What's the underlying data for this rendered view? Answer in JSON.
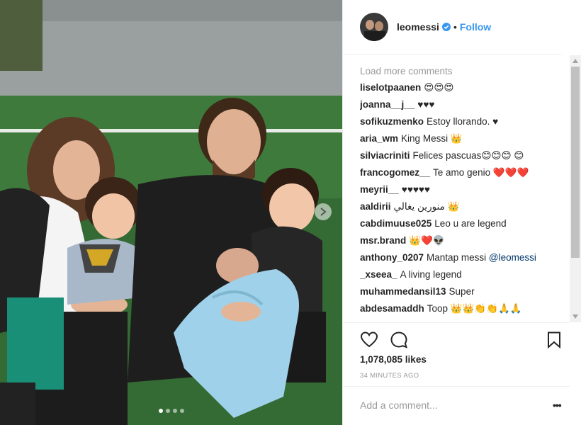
{
  "header": {
    "username": "leomessi",
    "verified": true,
    "separator": "•",
    "follow_label": "Follow"
  },
  "comments": {
    "load_more": "Load more comments",
    "items": [
      {
        "user": "liselotpaanen",
        "text": "😍😍😍"
      },
      {
        "user": "joanna__j__",
        "text": "♥♥♥"
      },
      {
        "user": "sofikuzmenko",
        "text": "Estoy llorando. ♥"
      },
      {
        "user": "aria_wm",
        "text": "King Messi 👑"
      },
      {
        "user": "silviacriniti",
        "text": "Felices pascuas😊😊😊 😊"
      },
      {
        "user": "francogomez__",
        "text": "Te amo genio ❤️❤️❤️"
      },
      {
        "user": "meyrii__",
        "text": "♥♥♥♥♥"
      },
      {
        "user": "aaldirii",
        "text": "منورين يغالي 👑"
      },
      {
        "user": "cabdimuuse025",
        "text": "Leo u are legend"
      },
      {
        "user": "msr.brand",
        "text": "👑❤️👽"
      },
      {
        "user": "anthony_0207",
        "text": "Mantap messi",
        "mention": "@leomessi"
      },
      {
        "user": "_xseea_",
        "text": "A living legend"
      },
      {
        "user": "muhammedansil13",
        "text": "Super"
      },
      {
        "user": "abdesamaddh",
        "text": "Toop 👑👑👏👏🙏🙏"
      }
    ]
  },
  "actions": {
    "like_icon": "heart-outline-icon",
    "comment_icon": "speech-bubble-icon",
    "save_icon": "bookmark-icon"
  },
  "likes": "1,078,085 likes",
  "timestamp": "34 MINUTES AGO",
  "add_comment": {
    "placeholder": "Add a comment...",
    "more_label": "•••"
  },
  "carousel": {
    "total_slides": 4,
    "active_slide": 1
  },
  "colors": {
    "accent": "#3897f0",
    "text": "#262626",
    "muted": "#999999",
    "border": "#efefef",
    "mention": "#003569"
  }
}
